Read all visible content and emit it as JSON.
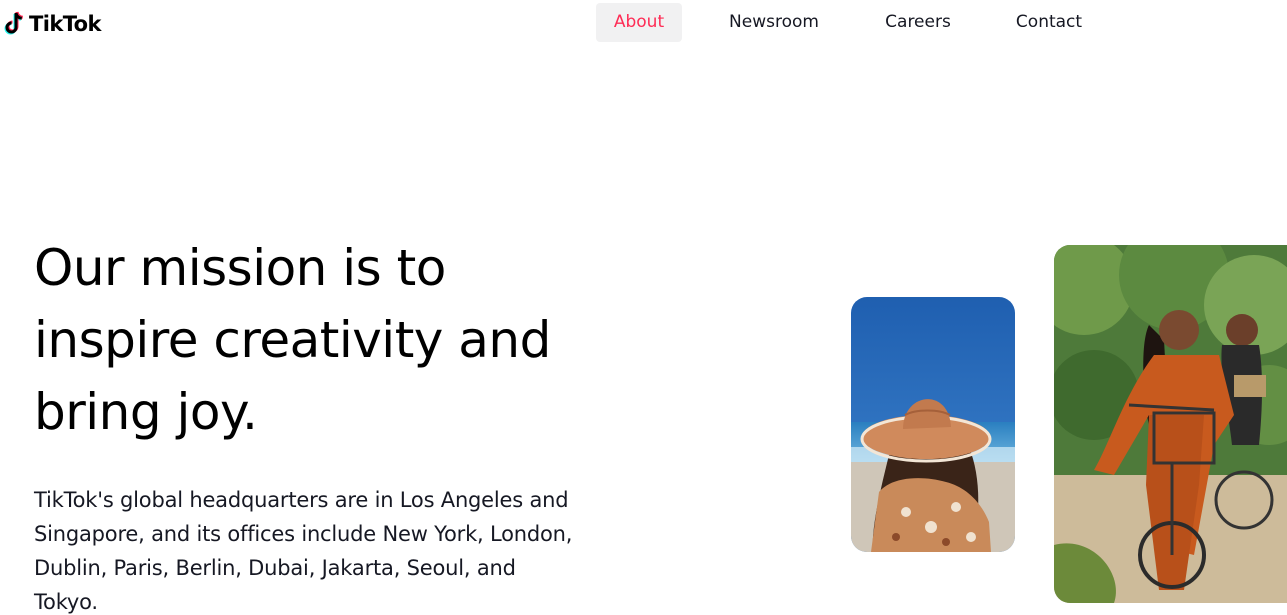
{
  "header": {
    "logo_text": "TikTok",
    "logo_icon": "tiktok-note-icon",
    "nav": [
      {
        "label": "About",
        "active": true
      },
      {
        "label": "Newsroom",
        "active": false
      },
      {
        "label": "Careers",
        "active": false
      },
      {
        "label": "Contact",
        "active": false
      }
    ]
  },
  "hero": {
    "headline": "Our mission is to inspire creativity and bring joy.",
    "body": "TikTok's global headquarters are in Los Angeles and Singapore, and its offices include New York, London, Dublin, Paris, Berlin, Dubai, Jakarta, Seoul, and Tokyo."
  },
  "images": [
    {
      "name": "woman-in-sun-hat-photo"
    },
    {
      "name": "women-riding-bicycles-photo"
    }
  ],
  "colors": {
    "accent": "#fe2c55",
    "active_tab_bg": "#f1f1f2",
    "text": "#161823",
    "logo_cyan": "#25f4ee",
    "logo_red": "#fe2c55"
  }
}
